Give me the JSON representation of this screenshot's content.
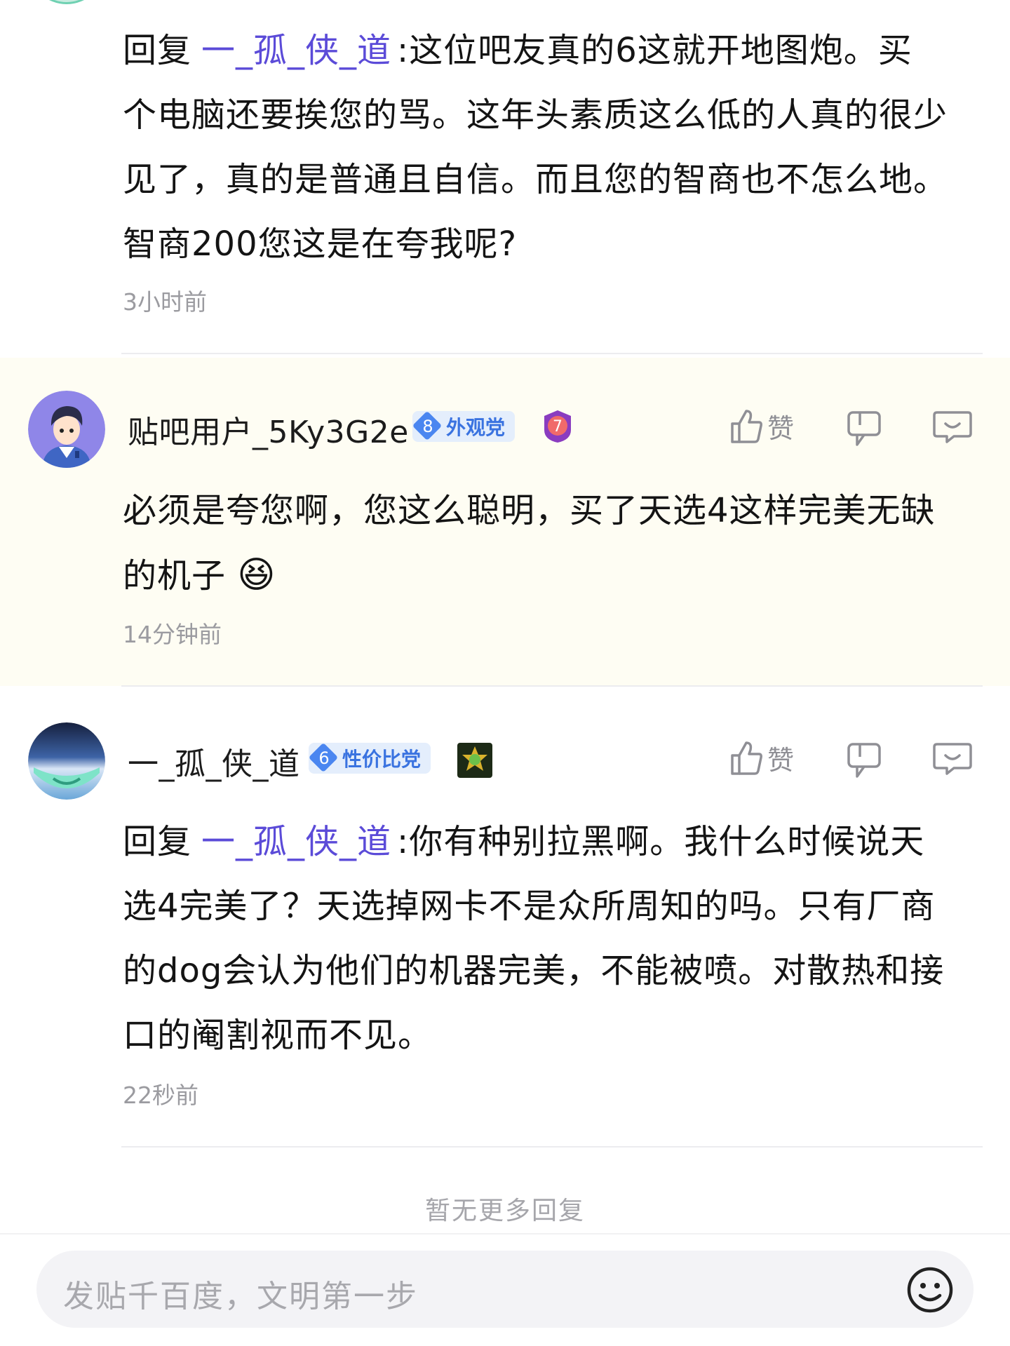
{
  "top_reply": {
    "prefix": "回复",
    "mention": "一_孤_侠_道",
    "lines": [
      ":这位吧友真的6这就开地图炮。买",
      "个电脑还要挨您的骂。这年头素质这么低的人真的很少",
      "见了，真的是普通且自信。而且您的智商也不怎么地。",
      "智商200您这是在夸我呢?"
    ],
    "time": "3小时前"
  },
  "comment1": {
    "username": "贴吧用户_5Ky3G2e",
    "badge_level": "8",
    "badge_text": "外观党",
    "extra_badge": "7",
    "like_label": "赞",
    "lines": [
      "必须是夸您啊，您这么聪明，买了天选4这样完美无缺",
      "的机子"
    ],
    "emoji": "😆",
    "time": "14分钟前"
  },
  "comment2": {
    "username": "一_孤_侠_道",
    "badge_level": "6",
    "badge_text": "性价比党",
    "like_label": "赞",
    "prefix": "回复",
    "mention": "一_孤_侠_道",
    "lines": [
      ":你有种别拉黑啊。我什么时候说天",
      "选4完美了？天选掉网卡不是众所周知的吗。只有厂商",
      "的dog会认为他们的机器完美，不能被喷。对散热和接",
      "口的阉割视而不见。"
    ],
    "time": "22秒前"
  },
  "no_more": "暂无更多回复",
  "input": {
    "placeholder": "发贴千百度，文明第一步"
  },
  "colors": {
    "mention": "#5b4bd8",
    "badge_blue": "#4a86f0",
    "highlight_bg": "#fefdf3"
  }
}
